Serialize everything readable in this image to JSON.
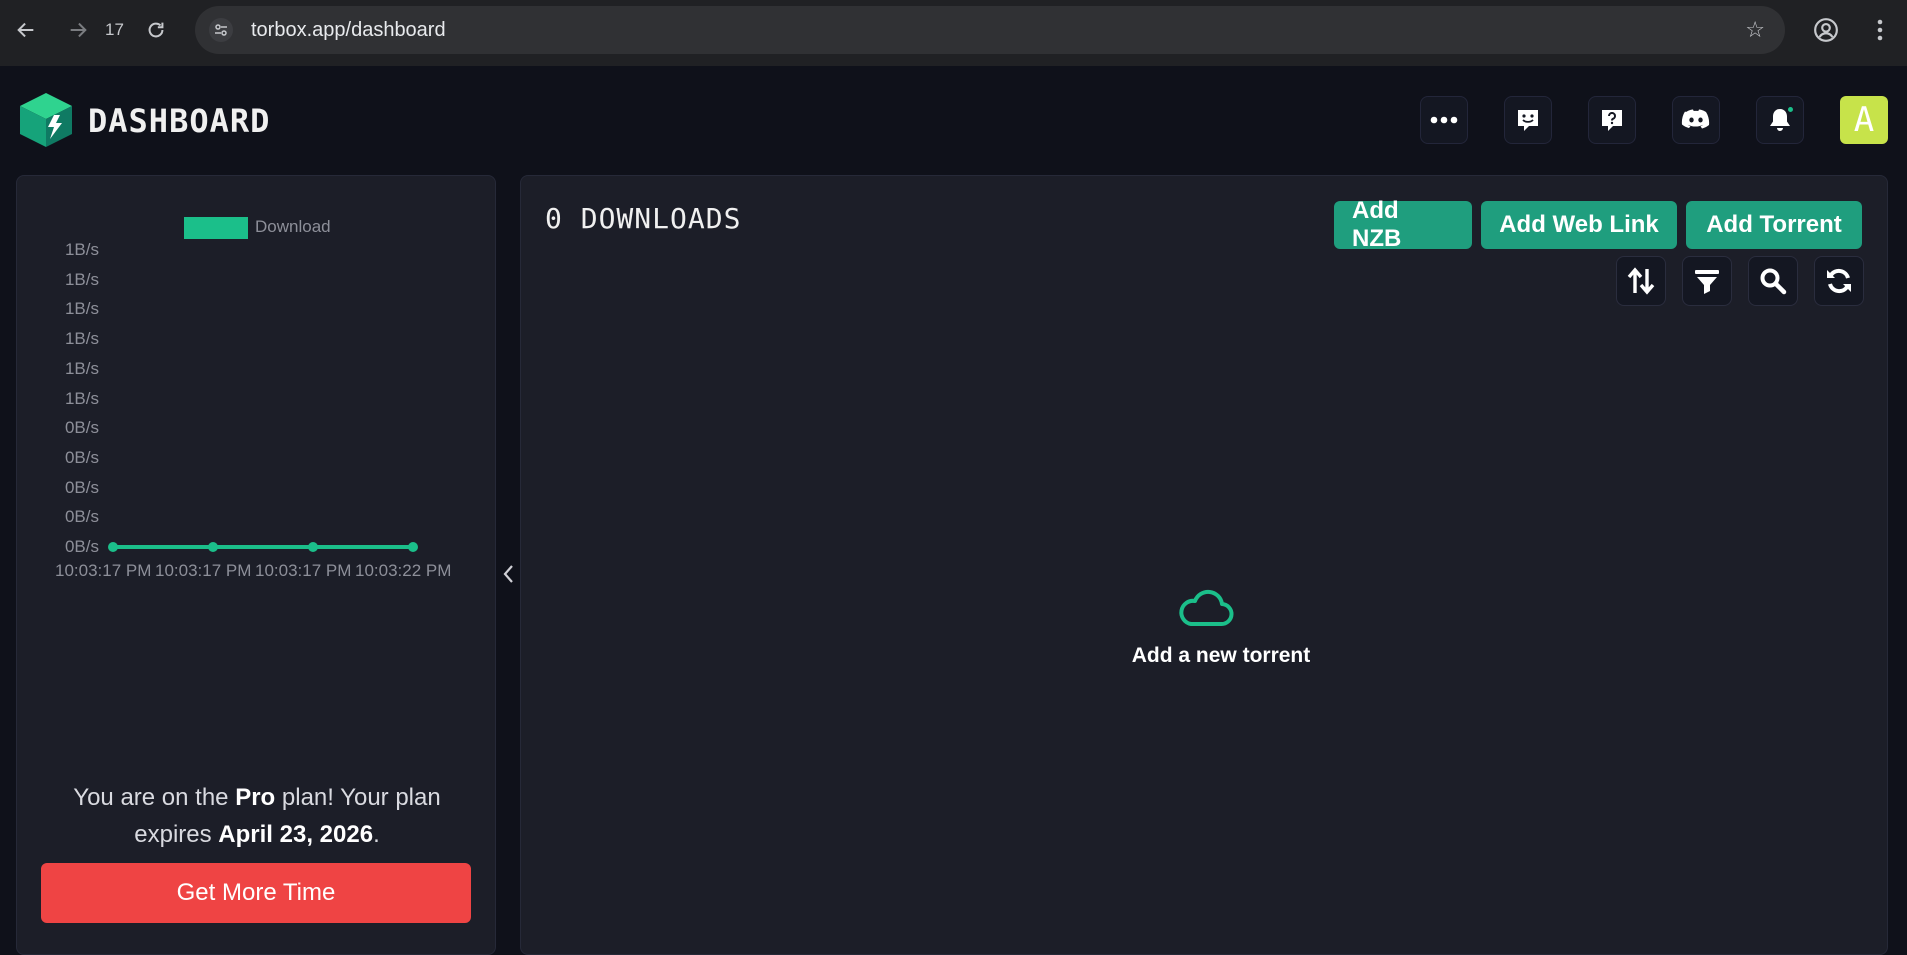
{
  "browser": {
    "tab_count": "17",
    "url": "torbox.app/dashboard"
  },
  "header": {
    "brand": "DASHBOARD",
    "avatar_letter": "A"
  },
  "chart_data": {
    "type": "line",
    "series": [
      {
        "name": "Download",
        "values": [
          0,
          0,
          0,
          0
        ]
      }
    ],
    "categories": [
      "10:03:17 PM",
      "10:03:17 PM",
      "10:03:17 PM",
      "10:03:22 PM"
    ],
    "ytick_labels": [
      "1B/s",
      "1B/s",
      "1B/s",
      "1B/s",
      "1B/s",
      "1B/s",
      "0B/s",
      "0B/s",
      "0B/s",
      "0B/s",
      "0B/s"
    ],
    "ylim": [
      0,
      1
    ],
    "grid": false,
    "legend": "top",
    "color": "#1bbf8a"
  },
  "plan": {
    "prefix": "You are on the ",
    "plan_name": "Pro",
    "middle": " plan! Your plan expires ",
    "expiry": "April 23, 2026",
    "suffix": ".",
    "cta": "Get More Time"
  },
  "downloads": {
    "title": "0 DOWNLOADS",
    "add_nzb": "Add NZB",
    "add_web_link": "Add Web Link",
    "add_torrent": "Add Torrent",
    "empty_text": "Add a new torrent"
  },
  "colors": {
    "accent": "#1bbf8a",
    "button": "#1f9e7e",
    "danger": "#ef4444",
    "avatar": "#c7e34a"
  }
}
